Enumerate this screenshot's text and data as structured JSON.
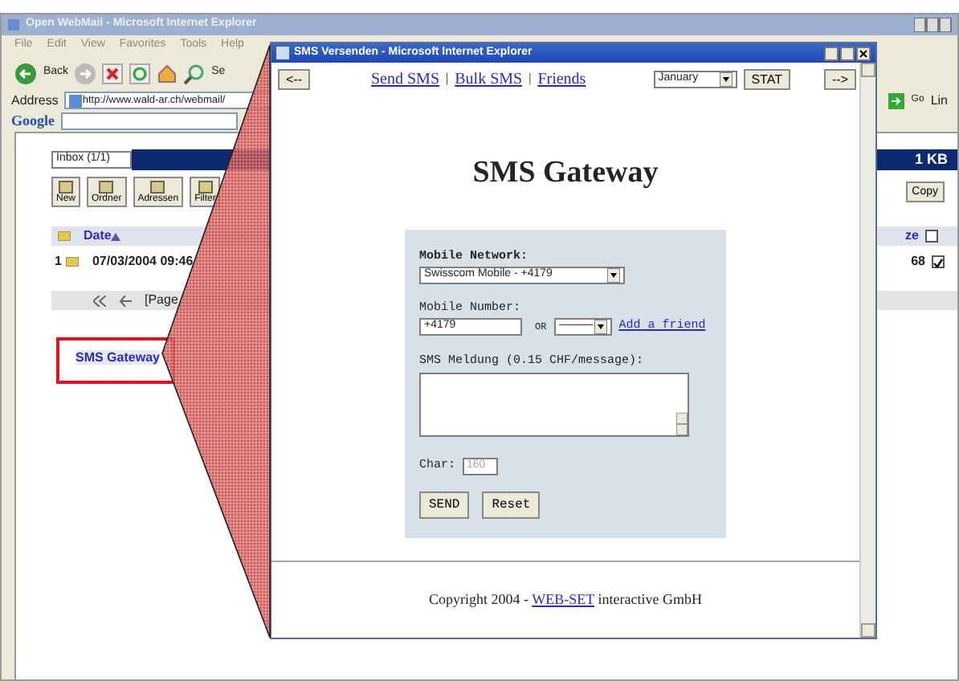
{
  "background_window": {
    "title": "Open WebMail - Microsoft Internet Explorer",
    "menu": [
      "File",
      "Edit",
      "View",
      "Favorites",
      "Tools",
      "Help"
    ],
    "back_label": "Back",
    "search_label": "Se",
    "address_label": "Address",
    "address": "http://www.wald-ar.ch/webmail/",
    "go_label": "Go",
    "links_label": "Lin",
    "google_label": "Google",
    "mail": {
      "folder": "Inbox (1/1)",
      "quota": "1 KB",
      "tools": [
        "New",
        "Ordner",
        "Adressen",
        "Filter"
      ],
      "copy": "Copy",
      "date_column": "Date",
      "size_column": "ze",
      "select_all": {
        "checked": false
      },
      "messages": [
        {
          "number": "1",
          "date": "07/03/2004 09:46",
          "size": "68",
          "checked": true
        }
      ],
      "pager": "[Page",
      "gateway_link": "SMS Gateway"
    }
  },
  "popup": {
    "title": "SMS Versenden - Microsoft Internet Explorer",
    "back": "<--",
    "forward": "-->",
    "nav_links": [
      "Send SMS",
      "Bulk SMS",
      "Friends"
    ],
    "nav_separator": "|",
    "month": "January",
    "stat": "STAT",
    "heading": "SMS Gateway",
    "form": {
      "network_label": "Mobile Network:",
      "network": "Swisscom Mobile - +4179",
      "number_label": "Mobile Number:",
      "number": "+4179",
      "or_label": "OR",
      "friend_select": "———",
      "add_friend": "Add a friend",
      "message_label": "SMS Meldung (0.15 CHF/message):",
      "char_label": "Char:",
      "char_field": {
        "value": "160",
        "disabled": true
      },
      "buttons": [
        "SEND",
        "Reset"
      ]
    },
    "footer": {
      "before": "Copyright 2004 - ",
      "link": "WEB-SET",
      "after": " interactive GmbH"
    }
  }
}
